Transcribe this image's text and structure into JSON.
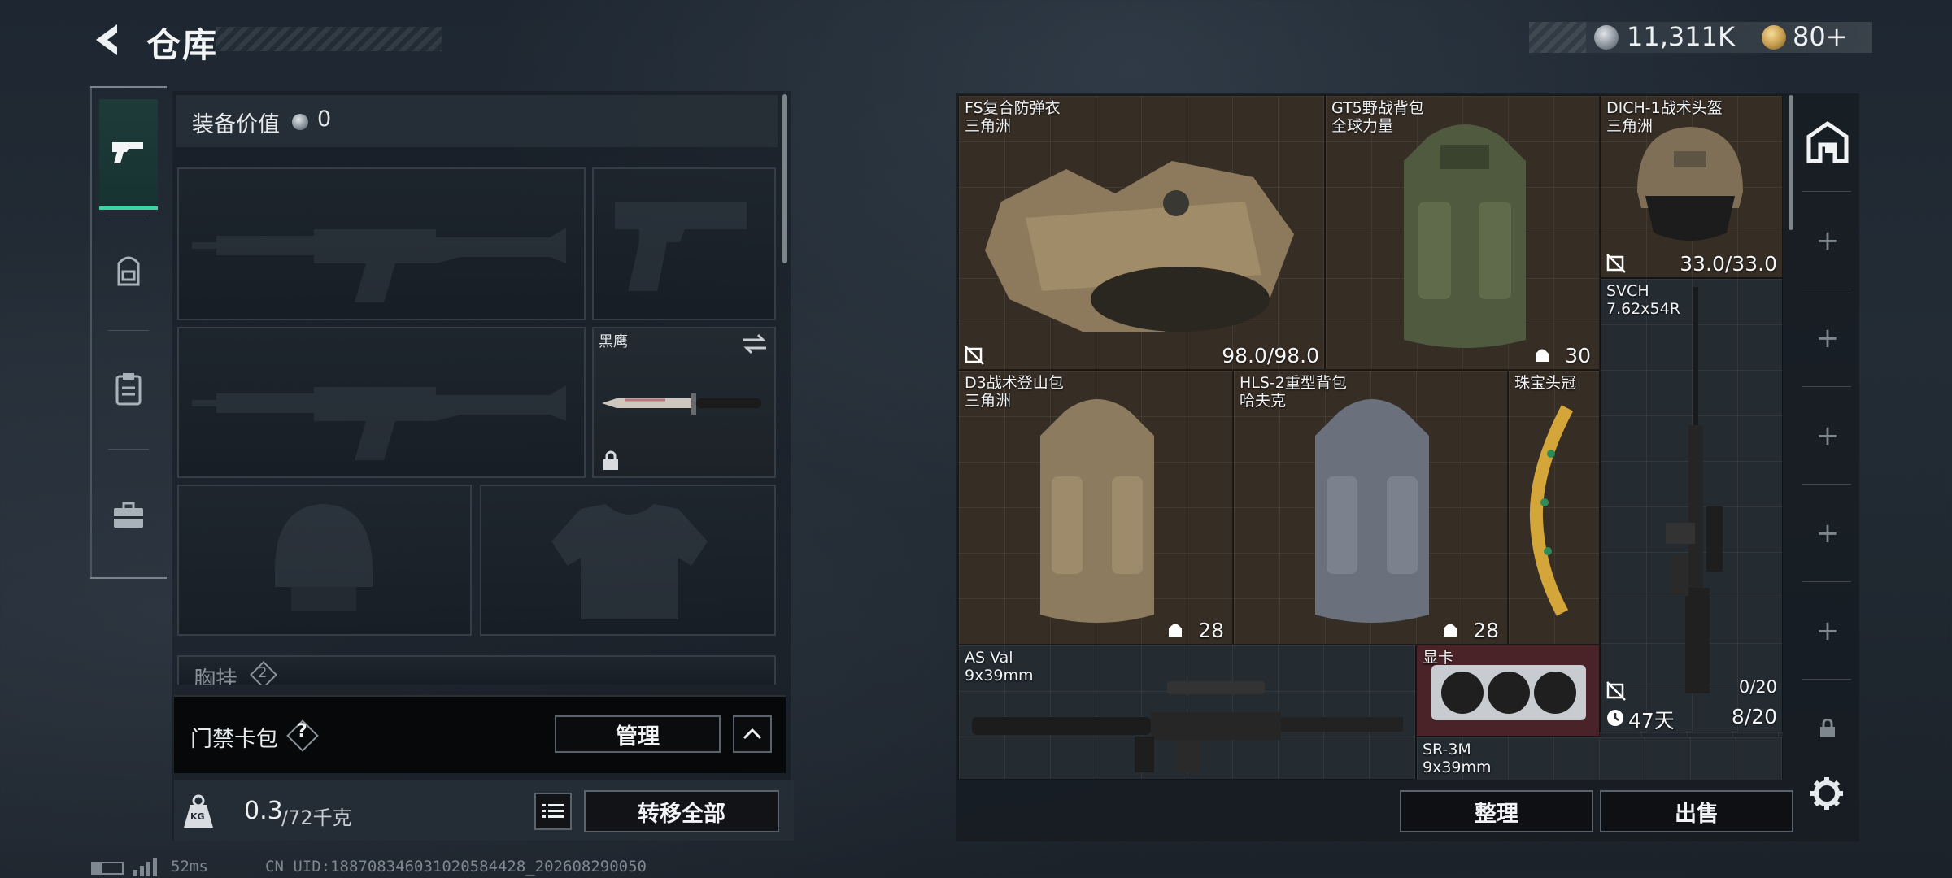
{
  "header": {
    "title": "仓库",
    "currencies": [
      {
        "icon": "silver-coin-icon",
        "value": "11,311K"
      },
      {
        "icon": "gold-coin-icon",
        "value": "80+"
      }
    ]
  },
  "sidebar": {
    "tabs": [
      {
        "name": "weapons",
        "icon": "pistol-icon",
        "active": true
      },
      {
        "name": "gear",
        "icon": "backpack-icon",
        "active": false
      },
      {
        "name": "rig",
        "icon": "clipboard-icon",
        "active": false
      },
      {
        "name": "case",
        "icon": "briefcase-icon",
        "active": false
      }
    ]
  },
  "loadout": {
    "equip_value_label": "装备价值",
    "equip_value": "0",
    "melee_label": "黑鹰",
    "chest_rig_label": "胸挂",
    "chest_rig_count": "2"
  },
  "keycard": {
    "label": "门禁卡包",
    "help": "?",
    "manage_button": "管理"
  },
  "footer_left": {
    "weight_icon_text": "KG",
    "weight_current": "0.3",
    "weight_max": "/72千克",
    "transfer_all_button": "转移全部"
  },
  "inventory": {
    "items": [
      {
        "name": "FS复合防弹衣",
        "sub": "三角洲",
        "value": "98.0/98.0"
      },
      {
        "name": "GT5野战背包",
        "sub": "全球力量",
        "value": "30"
      },
      {
        "name": "DICH-1战术头盔",
        "sub": "三角洲",
        "value": "33.0/33.0"
      },
      {
        "name": "SVCH",
        "sub": "7.62x54R",
        "value": "47天",
        "value2": "0/20",
        "value3": "8/20"
      },
      {
        "name": "D3战术登山包",
        "sub": "三角洲",
        "value": "28"
      },
      {
        "name": "HLS-2重型背包",
        "sub": "哈夫克",
        "value": "28"
      },
      {
        "name": "珠宝头冠",
        "sub": ""
      },
      {
        "name": "AS Val",
        "sub": "9x39mm"
      },
      {
        "name": "显卡",
        "sub": ""
      },
      {
        "name": "SR-3M",
        "sub": "9x39mm"
      }
    ],
    "sort_button": "整理",
    "sell_button": "出售"
  },
  "status": {
    "ping": "52ms",
    "uid": "CN UID:188708346031020584428_202608290050"
  },
  "colors": {
    "accent": "#3fd2a4",
    "item_brown": "#362d25",
    "item_red": "#4a2328"
  }
}
